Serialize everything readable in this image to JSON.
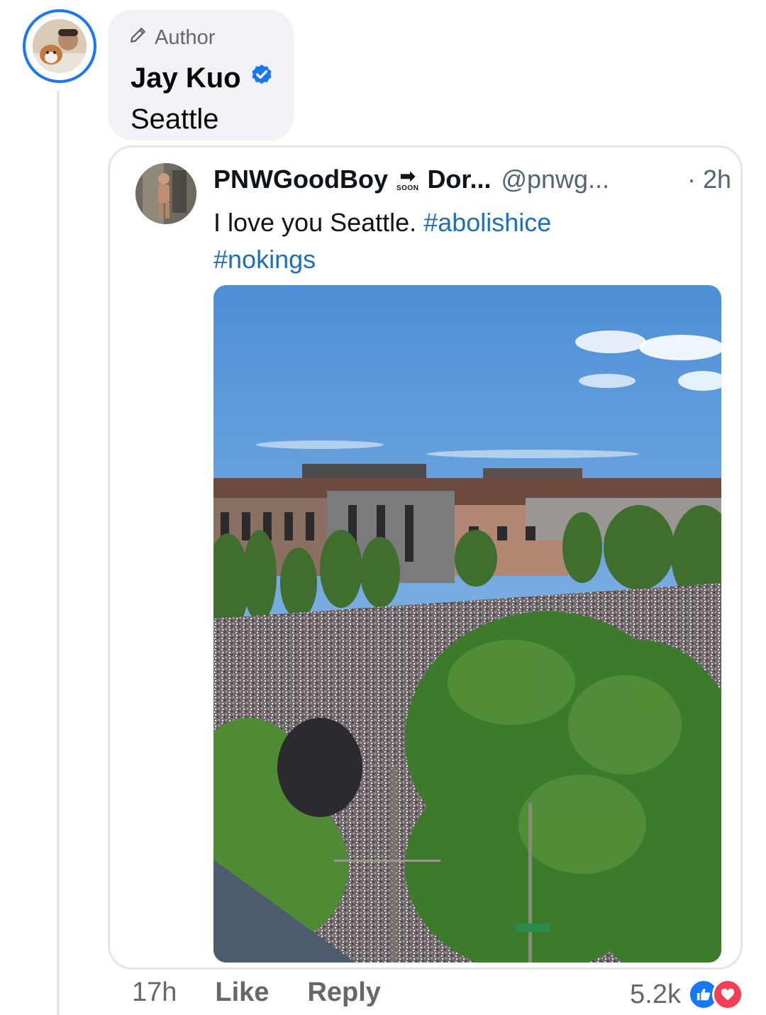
{
  "comment": {
    "author_badge": "Author",
    "author_name": "Jay Kuo",
    "text": "Seattle"
  },
  "shared_post": {
    "display_name": "PNWGoodBoy",
    "name_suffix": "Dor...",
    "soon_label": "SOON",
    "handle": "@pnwg...",
    "time": "· 2h",
    "text_plain": "I love you Seattle.",
    "hashtag_1": "#abolishice",
    "hashtag_2": "#nokings"
  },
  "footer": {
    "time": "17h",
    "like_label": "Like",
    "reply_label": "Reply",
    "reaction_count": "5.2k"
  },
  "colors": {
    "accent": "#1877f2",
    "hashtag": "#1d6fb8",
    "love": "#f33e58"
  },
  "icons": [
    "pencil-icon",
    "verified-icon",
    "soon-arrow-icon",
    "like-reaction-icon",
    "love-reaction-icon"
  ]
}
